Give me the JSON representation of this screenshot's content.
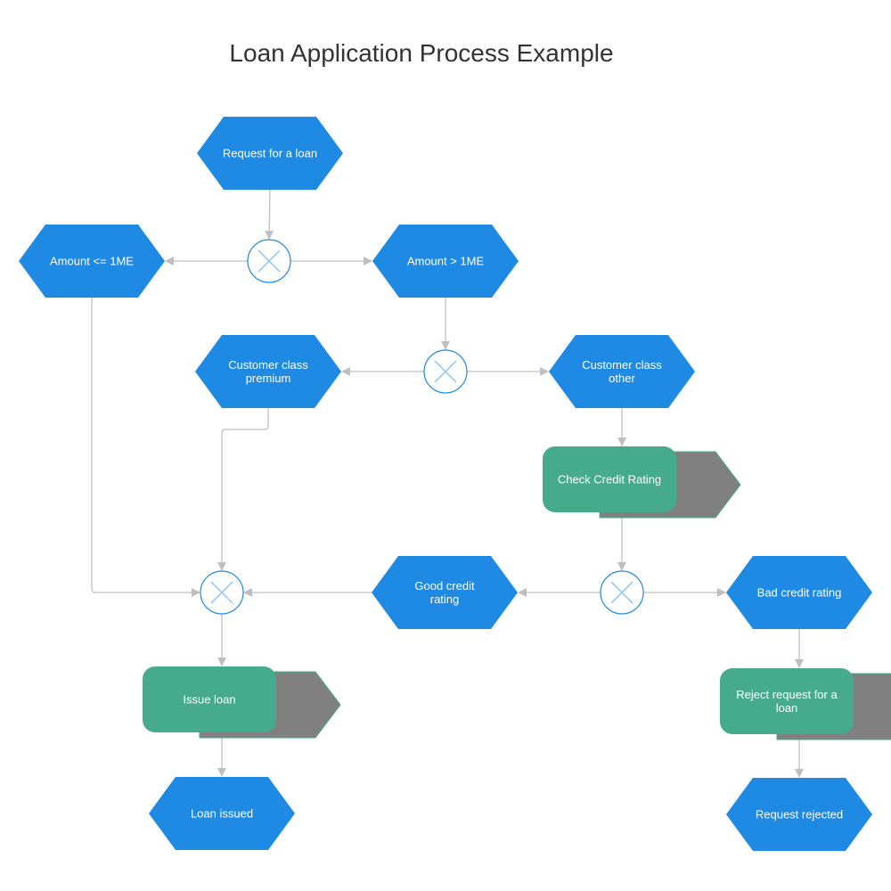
{
  "title": "Loan Application Process Example",
  "colors": {
    "event": "#1e8ae4",
    "function": "#45ab8c",
    "function_shadow": "#808080",
    "connector_stroke": "#1e8ae4",
    "connector_x": "#8cc4ee",
    "edge": "#bfbfbf",
    "title_text": "#333333"
  },
  "nodes": [
    {
      "id": "request_loan",
      "type": "event",
      "lines": [
        "Request for a loan"
      ]
    },
    {
      "id": "xor1",
      "type": "xor"
    },
    {
      "id": "amount_le",
      "type": "event",
      "lines": [
        "Amount <= 1ME"
      ]
    },
    {
      "id": "amount_gt",
      "type": "event",
      "lines": [
        "Amount > 1ME"
      ]
    },
    {
      "id": "xor2",
      "type": "xor"
    },
    {
      "id": "class_premium",
      "type": "event",
      "lines": [
        "Customer class",
        "premium"
      ]
    },
    {
      "id": "class_other",
      "type": "event",
      "lines": [
        "Customer class",
        "other"
      ]
    },
    {
      "id": "check_credit",
      "type": "function",
      "lines": [
        "Check Credit Rating"
      ]
    },
    {
      "id": "xor3",
      "type": "xor"
    },
    {
      "id": "good_credit",
      "type": "event",
      "lines": [
        "Good credit",
        "rating"
      ]
    },
    {
      "id": "bad_credit",
      "type": "event",
      "lines": [
        "Bad credit rating"
      ]
    },
    {
      "id": "xor4",
      "type": "xor"
    },
    {
      "id": "issue_loan",
      "type": "function",
      "lines": [
        "Issue loan"
      ]
    },
    {
      "id": "loan_issued",
      "type": "event",
      "lines": [
        "Loan issued"
      ]
    },
    {
      "id": "reject_request",
      "type": "function",
      "lines": [
        "Reject request for a",
        "loan"
      ]
    },
    {
      "id": "request_rejected",
      "type": "event",
      "lines": [
        "Request rejected"
      ]
    }
  ],
  "edges": [
    {
      "from": "request_loan",
      "to": "xor1"
    },
    {
      "from": "xor1",
      "to": "amount_le"
    },
    {
      "from": "xor1",
      "to": "amount_gt"
    },
    {
      "from": "amount_gt",
      "to": "xor2"
    },
    {
      "from": "xor2",
      "to": "class_premium"
    },
    {
      "from": "xor2",
      "to": "class_other"
    },
    {
      "from": "class_other",
      "to": "check_credit"
    },
    {
      "from": "check_credit",
      "to": "xor3"
    },
    {
      "from": "xor3",
      "to": "good_credit"
    },
    {
      "from": "xor3",
      "to": "bad_credit"
    },
    {
      "from": "good_credit",
      "to": "xor4"
    },
    {
      "from": "class_premium",
      "to": "xor4"
    },
    {
      "from": "amount_le",
      "to": "xor4"
    },
    {
      "from": "xor4",
      "to": "issue_loan"
    },
    {
      "from": "issue_loan",
      "to": "loan_issued"
    },
    {
      "from": "bad_credit",
      "to": "reject_request"
    },
    {
      "from": "reject_request",
      "to": "request_rejected"
    }
  ]
}
